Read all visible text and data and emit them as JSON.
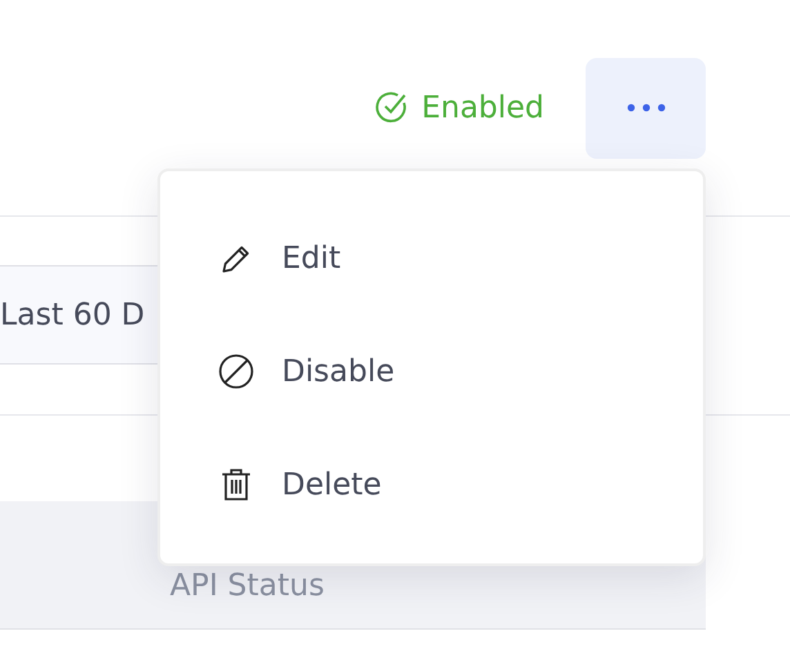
{
  "status": {
    "label": "Enabled"
  },
  "filter": {
    "value": "Last 60 D"
  },
  "table": {
    "columns": [
      "API Status"
    ]
  },
  "menu": {
    "items": [
      {
        "kind": "edit",
        "label": "Edit"
      },
      {
        "kind": "disable",
        "label": "Disable"
      },
      {
        "kind": "delete",
        "label": "Delete"
      }
    ]
  }
}
